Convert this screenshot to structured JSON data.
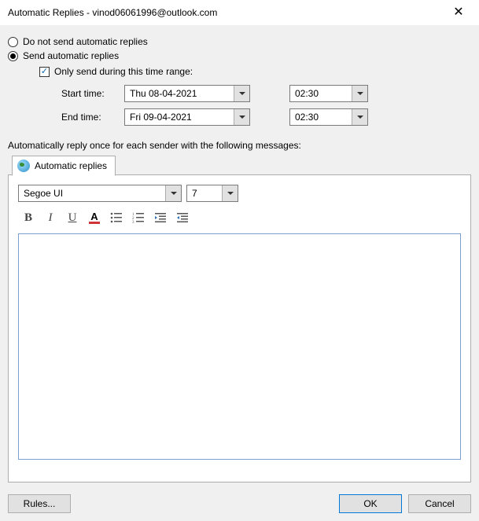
{
  "window": {
    "title": "Automatic Replies - vinod06061996@outlook.com"
  },
  "options": {
    "doNotSend": "Do not send automatic replies",
    "send": "Send automatic replies",
    "sendSelected": true,
    "onlyDuringRange": "Only send during this time range:",
    "onlyDuringChecked": true
  },
  "range": {
    "startLabel": "Start time:",
    "startDate": "Thu 08-04-2021",
    "startTime": "02:30",
    "endLabel": "End time:",
    "endDate": "Fri 09-04-2021",
    "endTime": "02:30"
  },
  "instruction": "Automatically reply once for each sender with the following messages:",
  "tab": {
    "label": "Automatic replies"
  },
  "editor": {
    "fontName": "Segoe UI",
    "fontSize": "7",
    "content": ""
  },
  "buttons": {
    "rules": "Rules...",
    "ok": "OK",
    "cancel": "Cancel"
  }
}
